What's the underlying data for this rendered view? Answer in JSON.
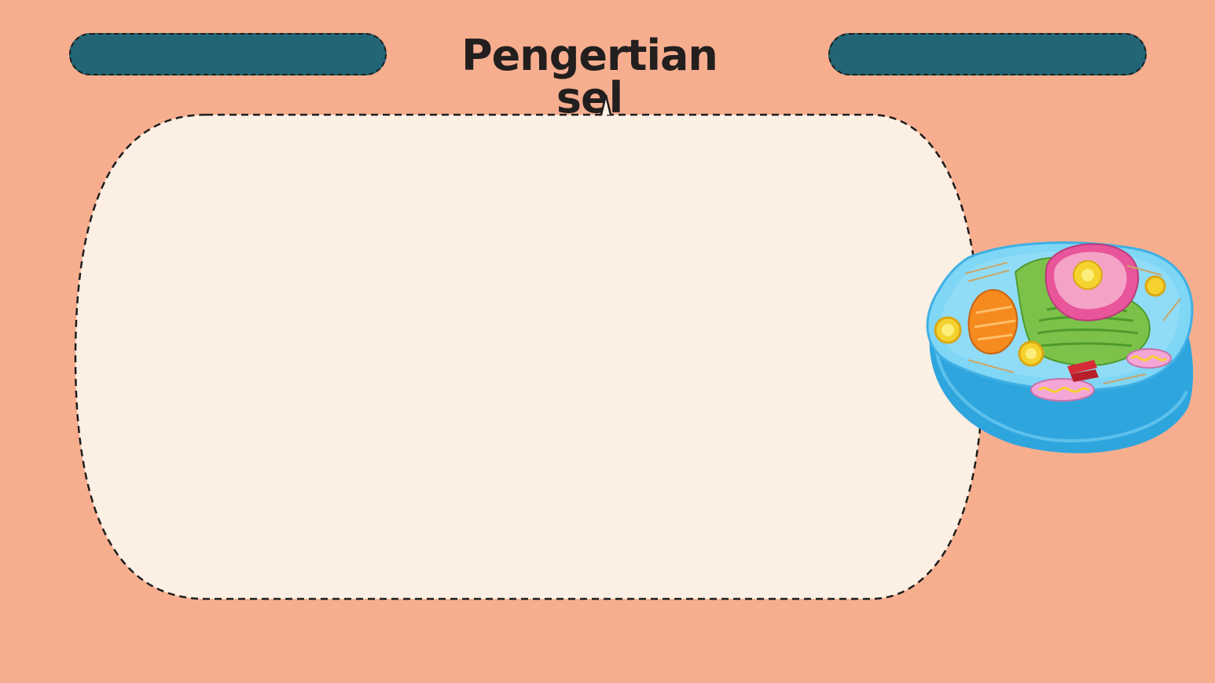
{
  "slide": {
    "title": "Pengertian sel"
  },
  "colors": {
    "background": "#f7ae8f",
    "panel": "#fcefe3",
    "pill": "#236574",
    "outline": "#1e1e1e"
  },
  "illustration": {
    "icon": "animal-cell-icon"
  }
}
